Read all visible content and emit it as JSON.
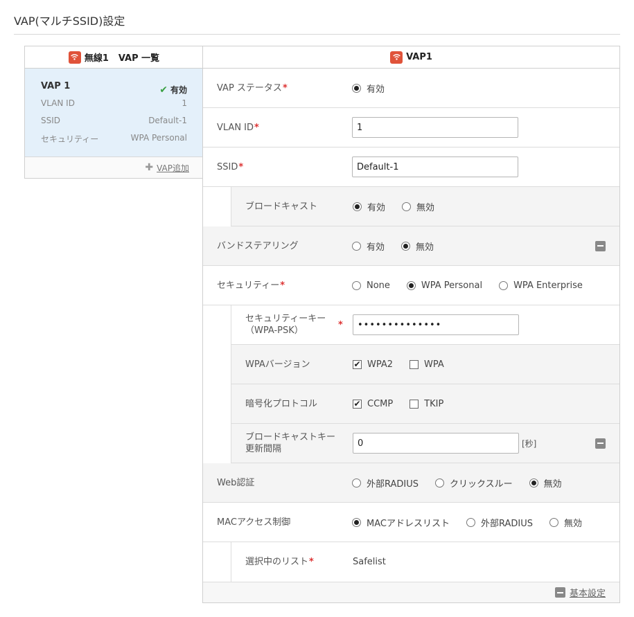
{
  "page": {
    "title": "VAP(マルチSSID)設定"
  },
  "left_panel": {
    "header_wifi": "無線1",
    "header_suffix": "VAP 一覧",
    "card": {
      "name": "VAP 1",
      "status": "有効",
      "vlan_label": "VLAN ID",
      "vlan_value": "1",
      "ssid_label": "SSID",
      "ssid_value": "Default-1",
      "security_label": "セキュリティー",
      "security_value": "WPA Personal"
    },
    "add_label": "VAP追加"
  },
  "right_panel": {
    "header": "VAP1",
    "vap_status": {
      "label": "VAP ステータス",
      "options": [
        "有効"
      ]
    },
    "vlan": {
      "label": "VLAN ID",
      "value": "1"
    },
    "ssid": {
      "label": "SSID",
      "value": "Default-1"
    },
    "broadcast": {
      "label": "ブロードキャスト",
      "options": [
        "有効",
        "無効"
      ]
    },
    "band_steering": {
      "label": "バンドステアリング",
      "options": [
        "有効",
        "無効"
      ]
    },
    "security": {
      "label": "セキュリティー",
      "options": [
        "None",
        "WPA Personal",
        "WPA Enterprise"
      ]
    },
    "security_key": {
      "label_line1": "セキュリティーキー",
      "label_line2": "（WPA-PSK）",
      "value": "••••••••••••••"
    },
    "wpa_version": {
      "label": "WPAバージョン",
      "options": [
        "WPA2",
        "WPA"
      ]
    },
    "encryption": {
      "label": "暗号化プロトコル",
      "options": [
        "CCMP",
        "TKIP"
      ]
    },
    "rekey": {
      "label_line1": "ブロードキャストキー",
      "label_line2": "更新間隔",
      "value": "0",
      "unit": "[秒]"
    },
    "web_auth": {
      "label": "Web認証",
      "options": [
        "外部RADIUS",
        "クリックスルー",
        "無効"
      ]
    },
    "mac_access": {
      "label": "MACアクセス制御",
      "options": [
        "MACアドレスリスト",
        "外部RADIUS",
        "無効"
      ]
    },
    "selected_list": {
      "label": "選択中のリスト",
      "value": "Safelist"
    },
    "footer_link": "基本設定"
  },
  "colors": {
    "accent_wifi": "#e0533a",
    "required": "#dd3333",
    "selected_card": "#e4f0fa",
    "check": "#3aa043"
  }
}
